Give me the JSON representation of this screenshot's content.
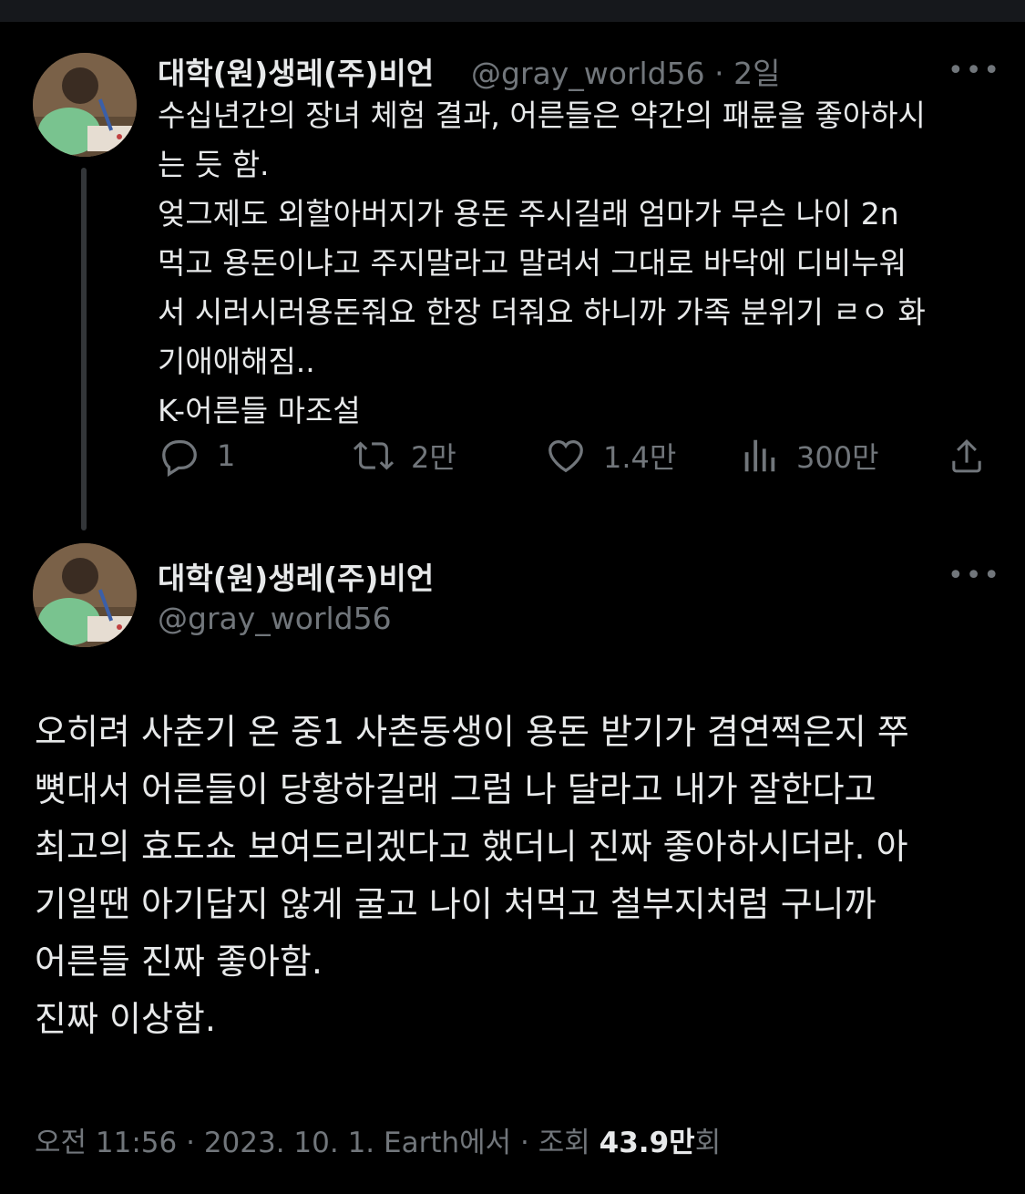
{
  "tweet1": {
    "display_name": "대학(원)생레(주)비언",
    "handle": "@gray_world56",
    "separator": "·",
    "age": "2일",
    "more": "•••",
    "text": "수십년간의 장녀 체험 결과, 어른들은 약간의 패륜을 좋아하시\n는 듯 함.\n엊그제도 외할아버지가 용돈 주시길래 엄마가 무슨 나이 2n\n먹고 용돈이냐고 주지말라고 말려서 그대로 바닥에 디비누워\n서 시러시러용돈줘요 한장 더줘요 하니까 가족 분위기 ㄹㅇ 화\n기애애해짐..\nK-어른들 마조설",
    "actions": {
      "reply_count": "1",
      "retweet_count": "2만",
      "like_count": "1.4만",
      "views_count": "300만"
    }
  },
  "tweet2": {
    "display_name": "대학(원)생레(주)비언",
    "handle": "@gray_world56",
    "more": "•••",
    "text": "오히려 사춘기 온 중1 사촌동생이 용돈 받기가 겸연쩍은지 쭈\n뼛대서 어른들이 당황하길래 그럼 나 달라고 내가 잘한다고\n최고의 효도쇼 보여드리겠다고 했더니 진짜 좋아하시더라. 아\n기일땐 아기답지 않게 굴고 나이 처먹고 철부지처럼 구니까\n어른들 진짜 좋아함.\n진짜 이상함.",
    "meta": {
      "time": "오전 11:56",
      "sep1": "·",
      "date": "2023. 10. 1.",
      "source": "Earth에서",
      "sep2": "·",
      "views_label": "조회",
      "views_value": "43.9만",
      "views_unit": "회"
    }
  },
  "colors": {
    "background": "#000000",
    "text_primary": "#e7e9ea",
    "text_secondary": "#71767b",
    "thread_line": "#333639"
  }
}
